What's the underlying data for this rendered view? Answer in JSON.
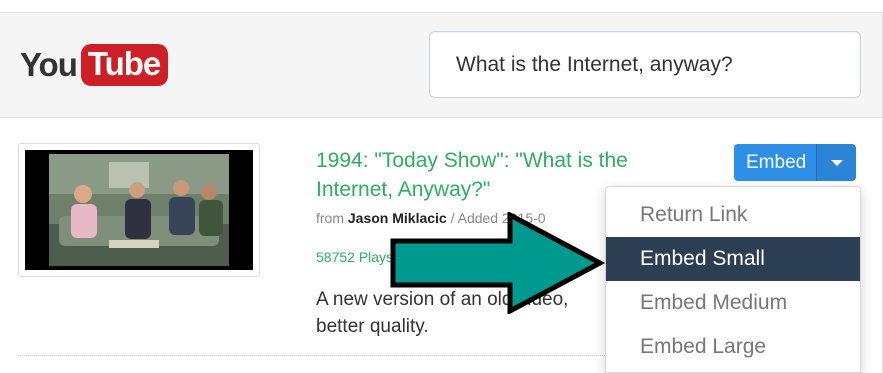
{
  "header": {
    "logo_you": "You",
    "logo_tube": "Tube",
    "search_value": "What is the Internet, anyway?"
  },
  "result": {
    "title": "1994: \"Today Show\": \"What is the Internet, Anyway?\"",
    "meta_from": "from ",
    "author": "Jason Miklacic",
    "meta_added": " / Added 2015-0",
    "plays": "58752 Plays",
    "description": "A new version of an old video, better quality."
  },
  "embed_button": {
    "label": "Embed"
  },
  "dropdown": {
    "items": [
      {
        "label": "Return Link",
        "active": false
      },
      {
        "label": "Embed Small",
        "active": true
      },
      {
        "label": "Embed Medium",
        "active": false
      },
      {
        "label": "Embed Large",
        "active": false
      }
    ]
  },
  "colors": {
    "accent_blue": "#2e8fe6",
    "title_green": "#2fae61",
    "active_item": "#2c3e52",
    "arrow_teal": "#009990",
    "youtube_red": "#cc2026"
  }
}
